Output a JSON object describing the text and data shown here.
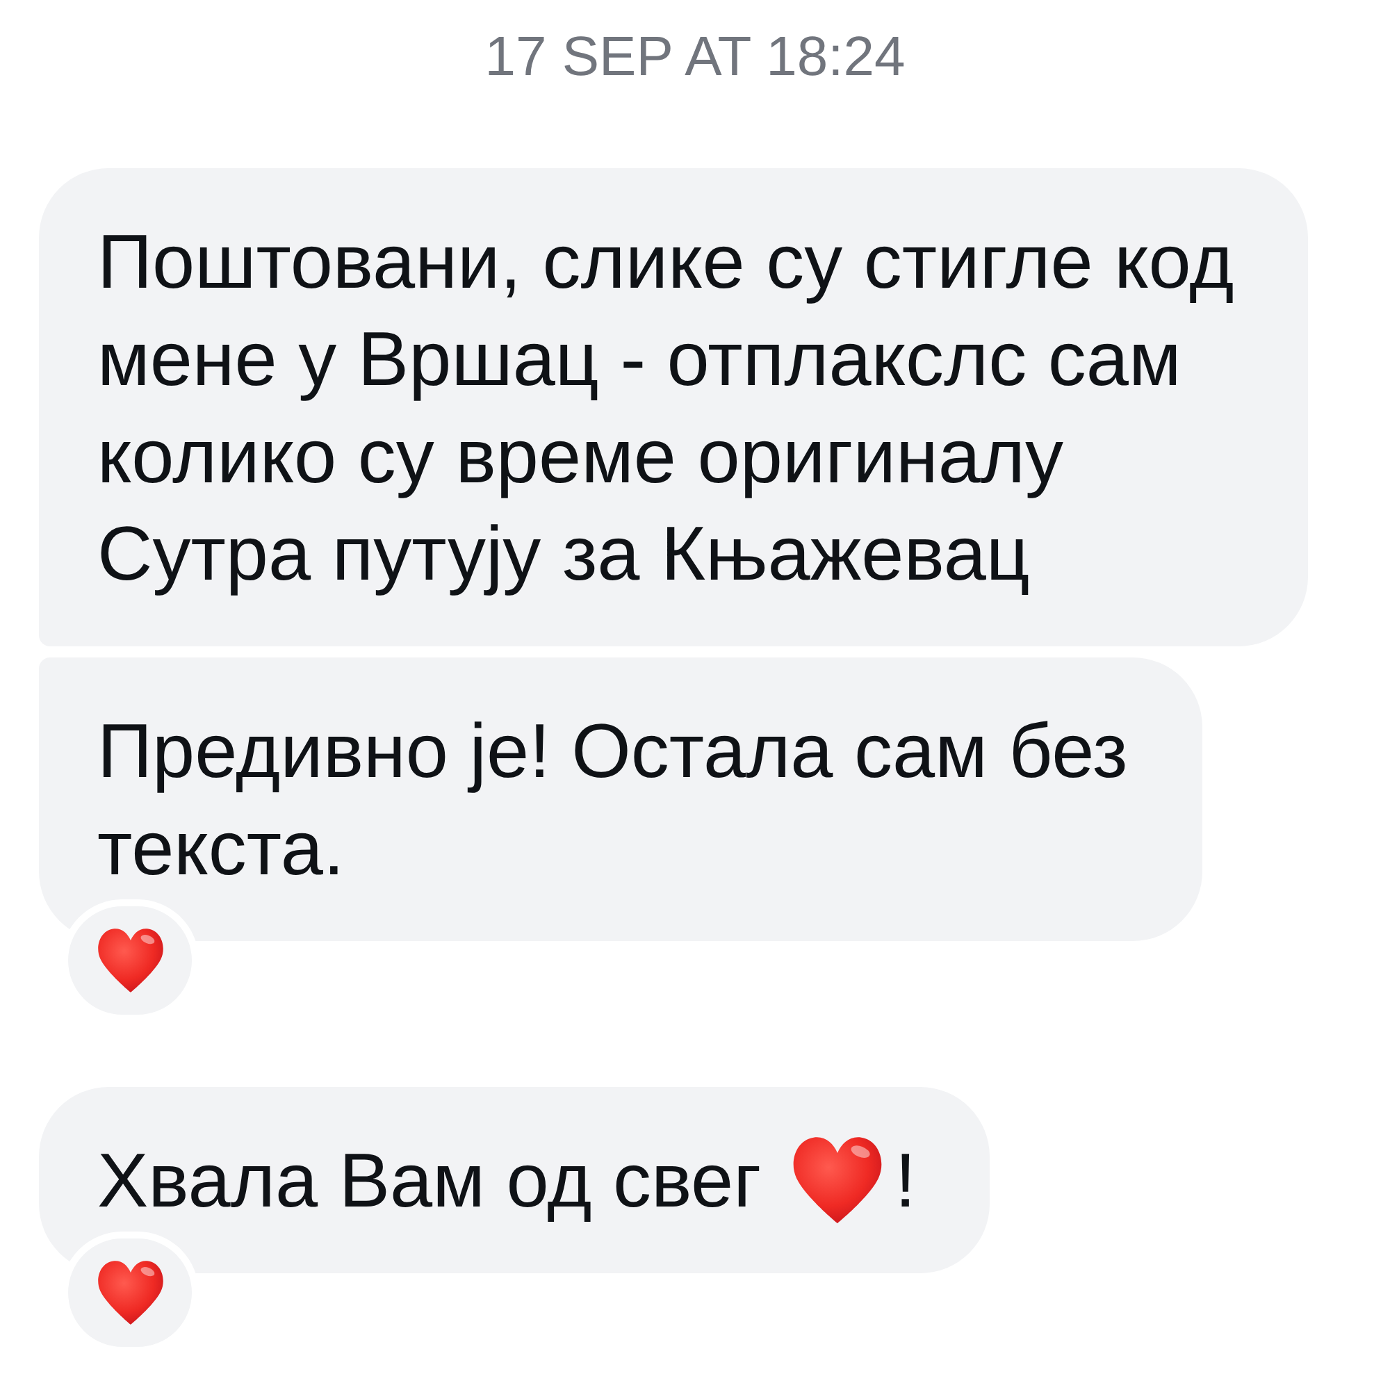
{
  "timestamp": "17 SEP AT 18:24",
  "groups": [
    {
      "messages": [
        {
          "parts": [
            {
              "kind": "text",
              "text": "Поштовани, слике су стигле код мене у Вршац - отплакслс сам колико су време оригиналу Сутра путују за Књажевац"
            }
          ],
          "reacted": false
        },
        {
          "parts": [
            {
              "kind": "text",
              "text": "Предивно је! Остала сам без текста."
            }
          ],
          "reacted": true
        }
      ]
    },
    {
      "messages": [
        {
          "parts": [
            {
              "kind": "text",
              "text": "Хвала Вам од свег"
            },
            {
              "kind": "emoji"
            },
            {
              "kind": "text",
              "text": "!"
            }
          ],
          "reacted": true
        }
      ]
    }
  ]
}
